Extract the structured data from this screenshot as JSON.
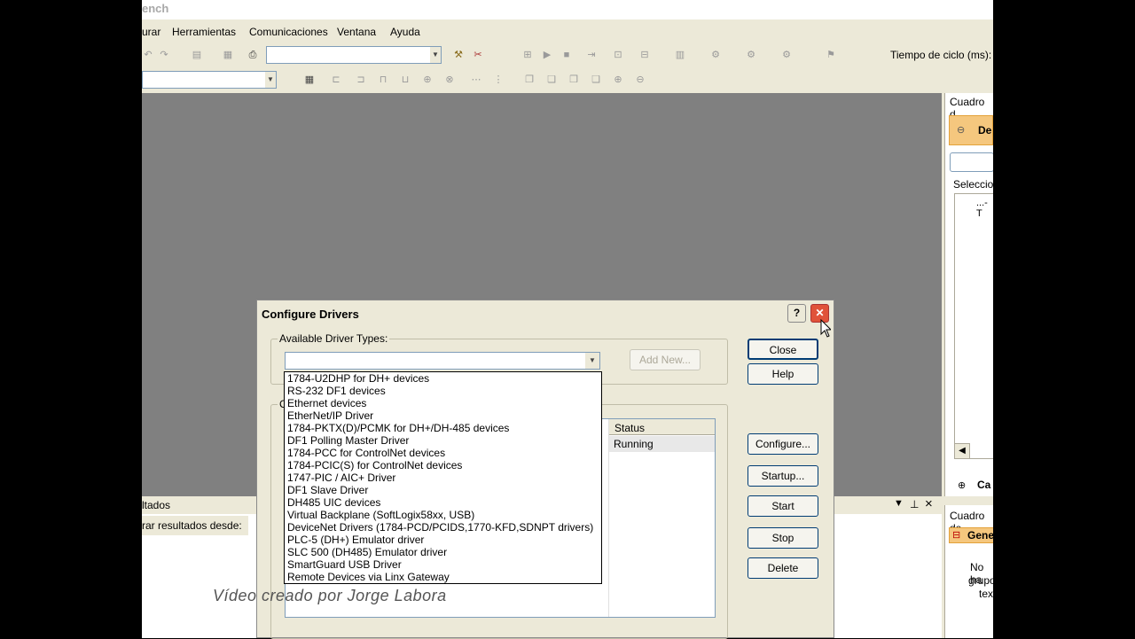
{
  "app": {
    "title_fragment": "ench"
  },
  "menu": {
    "items": [
      "urar",
      "Herramientas",
      "Comunicaciones",
      "Ventana",
      "Ayuda"
    ]
  },
  "toolbar": {
    "cycle_time_label": "Tiempo de ciclo (ms):"
  },
  "right_panel": {
    "header": "Cuadro d",
    "section": "De",
    "selection_label": "Seleccion",
    "tree_item": "...-T",
    "collapsed_label": "Ca"
  },
  "output_panel": {
    "title": "ltados",
    "filter_label": "rar resultados desde:"
  },
  "right_panel2": {
    "header": "Cuadro de",
    "section": "Gene",
    "text_lines": [
      "No ha",
      "grupo",
      "tex"
    ]
  },
  "dialog": {
    "title": "Configure Drivers",
    "help_btn": "?",
    "close_x": "✕",
    "available_label": "Available Driver Types:",
    "add_new": "Add New...",
    "configured_label_fragment": "C",
    "table_header_status": "Status",
    "table_row_status": "Running",
    "buttons": {
      "close": "Close",
      "help": "Help",
      "configure": "Configure...",
      "startup": "Startup...",
      "start": "Start",
      "stop": "Stop",
      "delete": "Delete"
    },
    "driver_options": [
      "1784-U2DHP for DH+ devices",
      "RS-232 DF1 devices",
      "Ethernet devices",
      "EtherNet/IP Driver",
      "1784-PKTX(D)/PCMK for DH+/DH-485 devices",
      "DF1 Polling Master Driver",
      "1784-PCC for ControlNet devices",
      "1784-PCIC(S) for ControlNet devices",
      "1747-PIC / AIC+ Driver",
      "DF1 Slave Driver",
      "DH485 UIC devices",
      "Virtual Backplane (SoftLogix58xx, USB)",
      "DeviceNet Drivers (1784-PCD/PCIDS,1770-KFD,SDNPT drivers)",
      "PLC-5 (DH+) Emulator driver",
      "SLC 500 (DH485) Emulator driver",
      "SmartGuard USB Driver",
      "Remote Devices via Linx Gateway"
    ]
  },
  "watermark": "Vídeo creado por Jorge Labora"
}
